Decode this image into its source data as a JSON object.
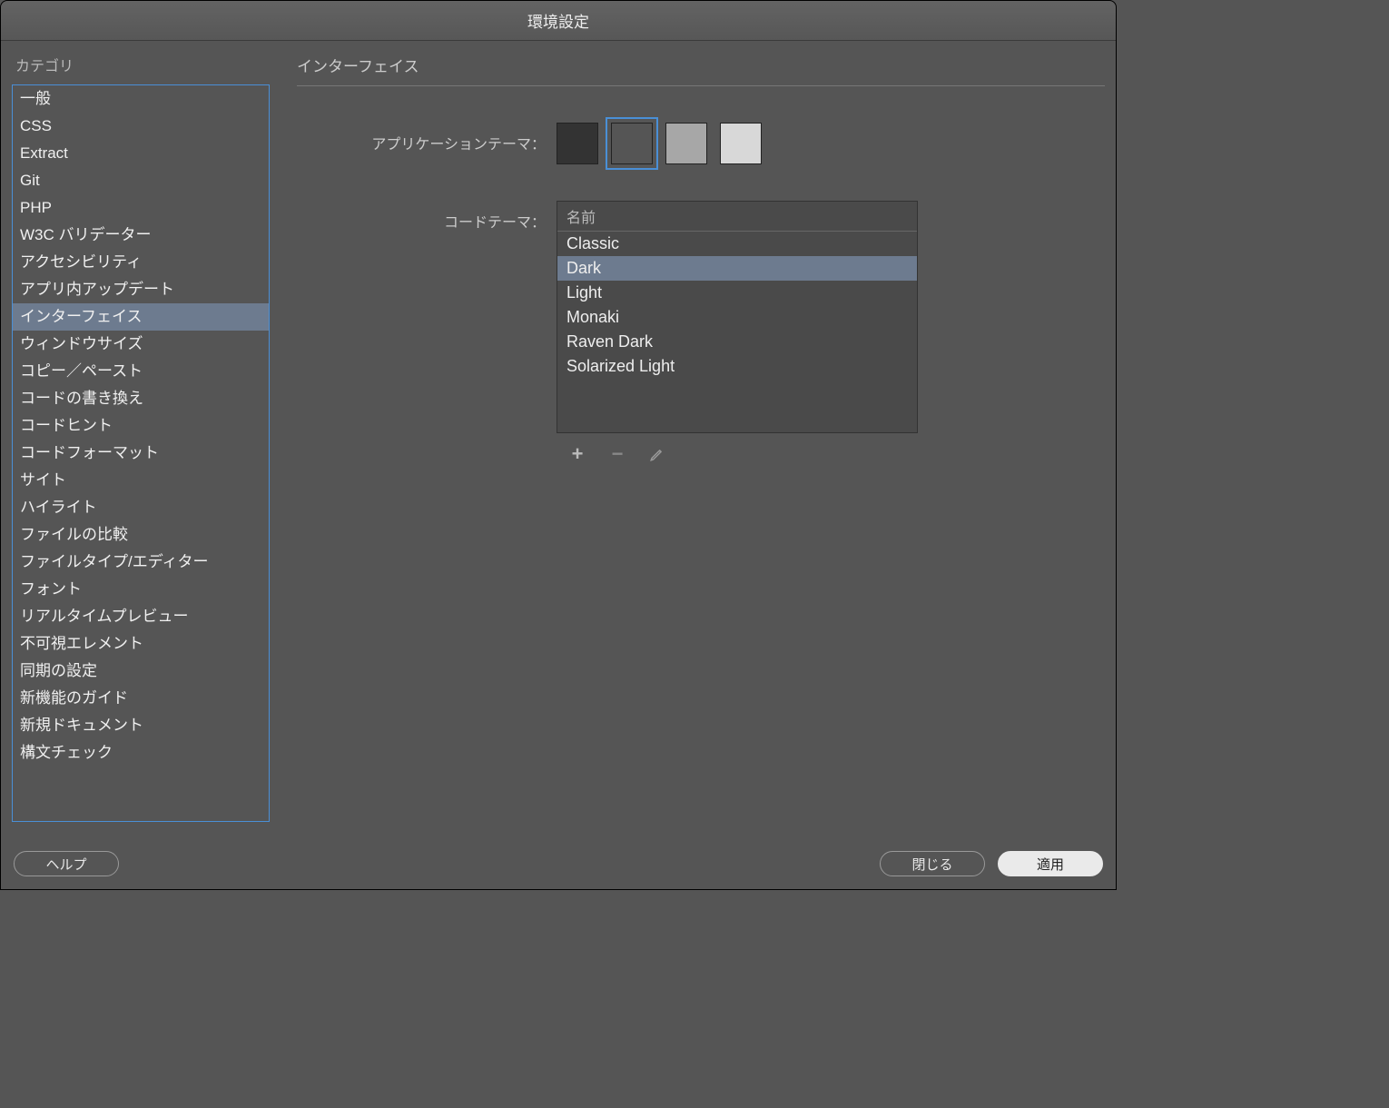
{
  "window": {
    "title": "環境設定"
  },
  "sidebar": {
    "label": "カテゴリ",
    "items": [
      "一般",
      "CSS",
      "Extract",
      "Git",
      "PHP",
      "W3C バリデーター",
      "アクセシビリティ",
      "アプリ内アップデート",
      "インターフェイス",
      "ウィンドウサイズ",
      "コピー／ペースト",
      "コードの書き換え",
      "コードヒント",
      "コードフォーマット",
      "サイト",
      "ハイライト",
      "ファイルの比較",
      "ファイルタイプ/エディター",
      "フォント",
      "リアルタイムプレビュー",
      "不可視エレメント",
      "同期の設定",
      "新機能のガイド",
      "新規ドキュメント",
      "構文チェック"
    ],
    "selected_index": 8
  },
  "main": {
    "title": "インターフェイス",
    "app_theme_label": "アプリケーションテーマ：",
    "swatches": [
      "#333333",
      "#555555",
      "#a7a7a7",
      "#d8d8d8"
    ],
    "swatch_selected_index": 1,
    "code_theme_label": "コードテーマ：",
    "theme_header": "名前",
    "themes": [
      "Classic",
      "Dark",
      "Light",
      "Monaki",
      "Raven Dark",
      "Solarized Light"
    ],
    "theme_selected_index": 1
  },
  "footer": {
    "help": "ヘルプ",
    "close": "閉じる",
    "apply": "適用"
  }
}
